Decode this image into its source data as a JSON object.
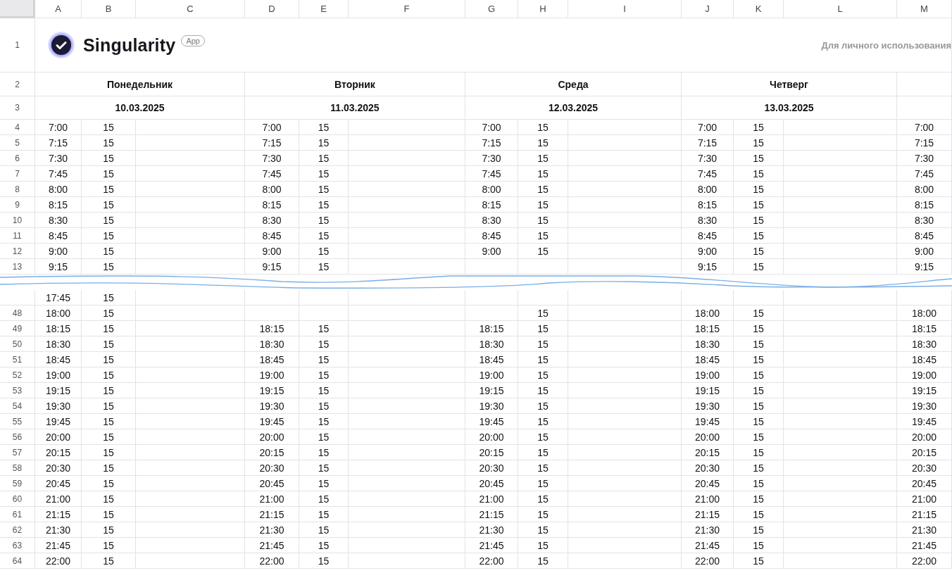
{
  "columns": [
    "A",
    "B",
    "C",
    "D",
    "E",
    "F",
    "G",
    "H",
    "I",
    "J",
    "K",
    "L",
    "M"
  ],
  "brand": {
    "row": "1",
    "name": "Singularity",
    "badge": "App",
    "note": "Для личного использования"
  },
  "days_row": "2",
  "dates_row": "3",
  "days": [
    {
      "name": "Понедельник",
      "date": "10.03.2025"
    },
    {
      "name": "Вторник",
      "date": "11.03.2025"
    },
    {
      "name": "Среда",
      "date": "12.03.2025"
    },
    {
      "name": "Четверг",
      "date": "13.03.2025"
    }
  ],
  "rows": [
    {
      "kind": "row",
      "number": "4",
      "cells": {
        "A": "7:00",
        "B": "15",
        "D": "7:00",
        "E": "15",
        "G": "7:00",
        "H": "15",
        "J": "7:00",
        "K": "15",
        "M": "7:00"
      }
    },
    {
      "kind": "row",
      "number": "5",
      "cells": {
        "A": "7:15",
        "B": "15",
        "D": "7:15",
        "E": "15",
        "G": "7:15",
        "H": "15",
        "J": "7:15",
        "K": "15",
        "M": "7:15"
      }
    },
    {
      "kind": "row",
      "number": "6",
      "cells": {
        "A": "7:30",
        "B": "15",
        "D": "7:30",
        "E": "15",
        "G": "7:30",
        "H": "15",
        "J": "7:30",
        "K": "15",
        "M": "7:30"
      }
    },
    {
      "kind": "row",
      "number": "7",
      "cells": {
        "A": "7:45",
        "B": "15",
        "D": "7:45",
        "E": "15",
        "G": "7:45",
        "H": "15",
        "J": "7:45",
        "K": "15",
        "M": "7:45"
      }
    },
    {
      "kind": "row",
      "number": "8",
      "cells": {
        "A": "8:00",
        "B": "15",
        "D": "8:00",
        "E": "15",
        "G": "8:00",
        "H": "15",
        "J": "8:00",
        "K": "15",
        "M": "8:00"
      }
    },
    {
      "kind": "row",
      "number": "9",
      "cells": {
        "A": "8:15",
        "B": "15",
        "D": "8:15",
        "E": "15",
        "G": "8:15",
        "H": "15",
        "J": "8:15",
        "K": "15",
        "M": "8:15"
      }
    },
    {
      "kind": "row",
      "number": "10",
      "cells": {
        "A": "8:30",
        "B": "15",
        "D": "8:30",
        "E": "15",
        "G": "8:30",
        "H": "15",
        "J": "8:30",
        "K": "15",
        "M": "8:30"
      }
    },
    {
      "kind": "row",
      "number": "11",
      "cells": {
        "A": "8:45",
        "B": "15",
        "D": "8:45",
        "E": "15",
        "G": "8:45",
        "H": "15",
        "J": "8:45",
        "K": "15",
        "M": "8:45"
      }
    },
    {
      "kind": "row",
      "number": "12",
      "cells": {
        "A": "9:00",
        "B": "15",
        "D": "9:00",
        "E": "15",
        "G": "9:00",
        "H": "15",
        "J": "9:00",
        "K": "15",
        "M": "9:00"
      }
    },
    {
      "kind": "row",
      "number": "13",
      "cells": {
        "A": "9:15",
        "B": "15",
        "D": "9:15",
        "E": "15",
        "J": "9:15",
        "K": "15",
        "M": "9:15"
      }
    },
    {
      "kind": "tear"
    },
    {
      "kind": "row",
      "cells": {
        "A": "17:45",
        "B": "15"
      }
    },
    {
      "kind": "row",
      "number": "48",
      "cells": {
        "A": "18:00",
        "B": "15",
        "H": "15",
        "J": "18:00",
        "K": "15",
        "M": "18:00"
      }
    },
    {
      "kind": "row",
      "number": "49",
      "cells": {
        "A": "18:15",
        "B": "15",
        "D": "18:15",
        "E": "15",
        "G": "18:15",
        "H": "15",
        "J": "18:15",
        "K": "15",
        "M": "18:15"
      }
    },
    {
      "kind": "row",
      "number": "50",
      "cells": {
        "A": "18:30",
        "B": "15",
        "D": "18:30",
        "E": "15",
        "G": "18:30",
        "H": "15",
        "J": "18:30",
        "K": "15",
        "M": "18:30"
      }
    },
    {
      "kind": "row",
      "number": "51",
      "cells": {
        "A": "18:45",
        "B": "15",
        "D": "18:45",
        "E": "15",
        "G": "18:45",
        "H": "15",
        "J": "18:45",
        "K": "15",
        "M": "18:45"
      }
    },
    {
      "kind": "row",
      "number": "52",
      "cells": {
        "A": "19:00",
        "B": "15",
        "D": "19:00",
        "E": "15",
        "G": "19:00",
        "H": "15",
        "J": "19:00",
        "K": "15",
        "M": "19:00"
      }
    },
    {
      "kind": "row",
      "number": "53",
      "cells": {
        "A": "19:15",
        "B": "15",
        "D": "19:15",
        "E": "15",
        "G": "19:15",
        "H": "15",
        "J": "19:15",
        "K": "15",
        "M": "19:15"
      }
    },
    {
      "kind": "row",
      "number": "54",
      "cells": {
        "A": "19:30",
        "B": "15",
        "D": "19:30",
        "E": "15",
        "G": "19:30",
        "H": "15",
        "J": "19:30",
        "K": "15",
        "M": "19:30"
      }
    },
    {
      "kind": "row",
      "number": "55",
      "cells": {
        "A": "19:45",
        "B": "15",
        "D": "19:45",
        "E": "15",
        "G": "19:45",
        "H": "15",
        "J": "19:45",
        "K": "15",
        "M": "19:45"
      }
    },
    {
      "kind": "row",
      "number": "56",
      "cells": {
        "A": "20:00",
        "B": "15",
        "D": "20:00",
        "E": "15",
        "G": "20:00",
        "H": "15",
        "J": "20:00",
        "K": "15",
        "M": "20:00"
      }
    },
    {
      "kind": "row",
      "number": "57",
      "cells": {
        "A": "20:15",
        "B": "15",
        "D": "20:15",
        "E": "15",
        "G": "20:15",
        "H": "15",
        "J": "20:15",
        "K": "15",
        "M": "20:15"
      }
    },
    {
      "kind": "row",
      "number": "58",
      "cells": {
        "A": "20:30",
        "B": "15",
        "D": "20:30",
        "E": "15",
        "G": "20:30",
        "H": "15",
        "J": "20:30",
        "K": "15",
        "M": "20:30"
      }
    },
    {
      "kind": "row",
      "number": "59",
      "cells": {
        "A": "20:45",
        "B": "15",
        "D": "20:45",
        "E": "15",
        "G": "20:45",
        "H": "15",
        "J": "20:45",
        "K": "15",
        "M": "20:45"
      }
    },
    {
      "kind": "row",
      "number": "60",
      "cells": {
        "A": "21:00",
        "B": "15",
        "D": "21:00",
        "E": "15",
        "G": "21:00",
        "H": "15",
        "J": "21:00",
        "K": "15",
        "M": "21:00"
      }
    },
    {
      "kind": "row",
      "number": "61",
      "cells": {
        "A": "21:15",
        "B": "15",
        "D": "21:15",
        "E": "15",
        "G": "21:15",
        "H": "15",
        "J": "21:15",
        "K": "15",
        "M": "21:15"
      }
    },
    {
      "kind": "row",
      "number": "62",
      "cells": {
        "A": "21:30",
        "B": "15",
        "D": "21:30",
        "E": "15",
        "G": "21:30",
        "H": "15",
        "J": "21:30",
        "K": "15",
        "M": "21:30"
      }
    },
    {
      "kind": "row",
      "number": "63",
      "cells": {
        "A": "21:45",
        "B": "15",
        "D": "21:45",
        "E": "15",
        "G": "21:45",
        "H": "15",
        "J": "21:45",
        "K": "15",
        "M": "21:45"
      }
    },
    {
      "kind": "row",
      "number": "64",
      "cells": {
        "A": "22:00",
        "B": "15",
        "D": "22:00",
        "E": "15",
        "G": "22:00",
        "H": "15",
        "J": "22:00",
        "K": "15",
        "M": "22:00"
      }
    }
  ]
}
